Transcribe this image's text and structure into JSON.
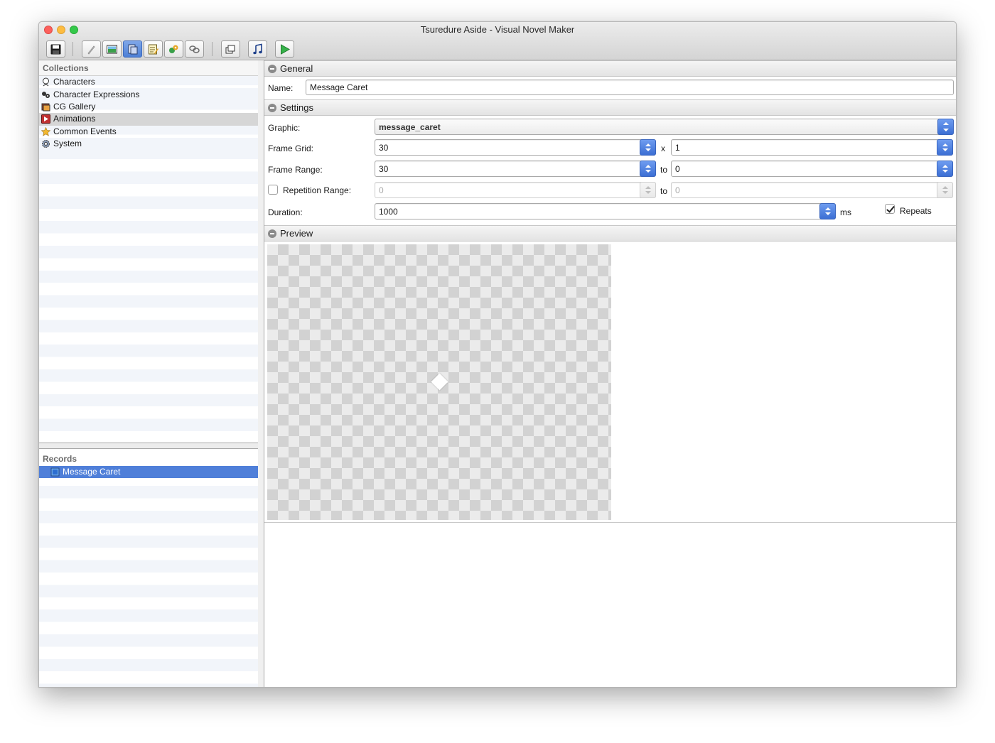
{
  "window": {
    "title": "Tsuredure Aside - Visual Novel Maker"
  },
  "toolbar": {
    "buttons": [
      {
        "icon": "save-icon",
        "tooltip": ""
      },
      {
        "icon": "pencil-icon",
        "tooltip": ""
      },
      {
        "icon": "image-icon",
        "tooltip": ""
      },
      {
        "icon": "database-icon",
        "tooltip": ""
      },
      {
        "icon": "script-icon",
        "tooltip": ""
      },
      {
        "icon": "plugins-icon",
        "tooltip": ""
      },
      {
        "icon": "links-icon",
        "tooltip": ""
      },
      {
        "icon": "layers-icon",
        "tooltip": ""
      },
      {
        "icon": "music-icon",
        "tooltip": ""
      },
      {
        "icon": "play-icon",
        "tooltip": ""
      }
    ]
  },
  "collections": {
    "header": "Collections",
    "items": [
      {
        "label": "Characters",
        "icon": "character-icon"
      },
      {
        "label": "Character Expressions",
        "icon": "expressions-icon"
      },
      {
        "label": "CG Gallery",
        "icon": "gallery-icon"
      },
      {
        "label": "Animations",
        "icon": "animation-icon",
        "highlighted": true
      },
      {
        "label": "Common Events",
        "icon": "star-icon"
      },
      {
        "label": "System",
        "icon": "gear-icon"
      }
    ]
  },
  "records": {
    "header": "Records",
    "items": [
      {
        "label": "Message Caret",
        "icon": "record-icon",
        "selected": true
      }
    ]
  },
  "general": {
    "title": "General",
    "name_label": "Name:",
    "name_value": "Message Caret"
  },
  "settings": {
    "title": "Settings",
    "graphic_label": "Graphic:",
    "graphic_value": "message_caret",
    "frame_grid_label": "Frame Grid:",
    "frame_grid_x": "30",
    "frame_grid_sep": "x",
    "frame_grid_y": "1",
    "frame_range_label": "Frame Range:",
    "frame_range_from": "30",
    "frame_range_sep": "to",
    "frame_range_to": "0",
    "repetition_label": "Repetition Range:",
    "repetition_checked": false,
    "repetition_from": "0",
    "repetition_sep": "to",
    "repetition_to": "0",
    "duration_label": "Duration:",
    "duration_value": "1000",
    "duration_unit": "ms",
    "repeats_label": "Repeats",
    "repeats_checked": true
  },
  "preview": {
    "title": "Preview"
  },
  "colors": {
    "accent": "#4f7fd9",
    "selection": "#4f7fd9"
  }
}
